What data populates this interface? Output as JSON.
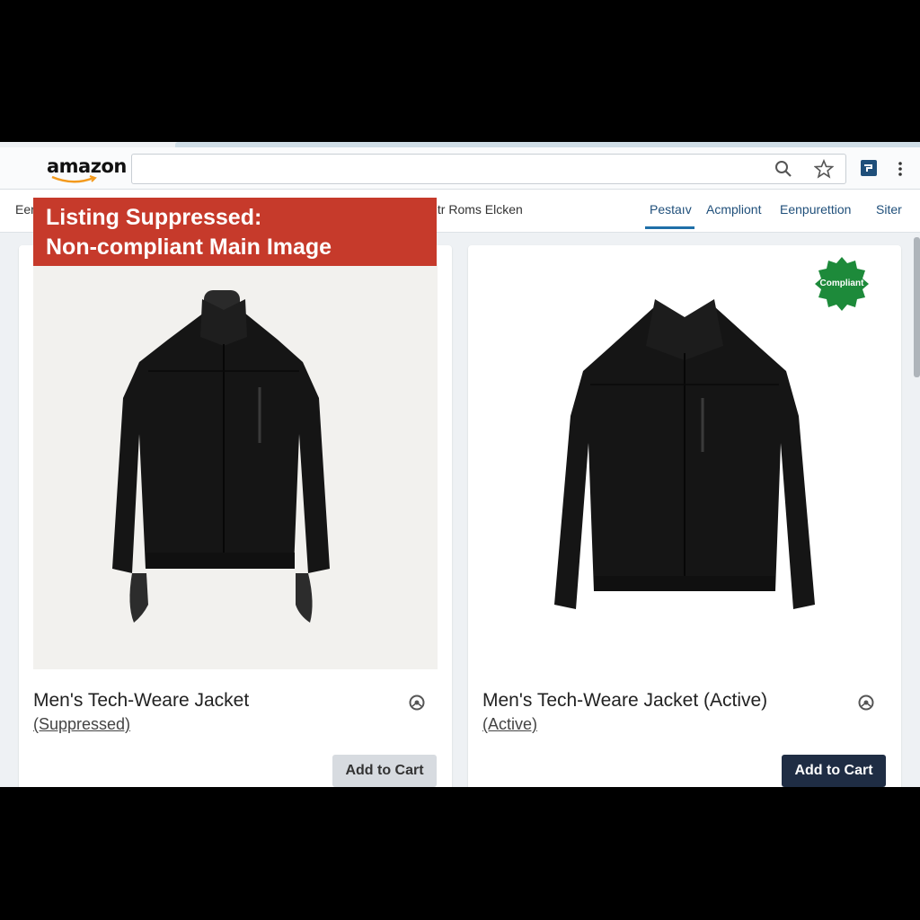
{
  "browser": {
    "logo_text": "amazon",
    "search": {
      "value": "",
      "placeholder": ""
    }
  },
  "nav": {
    "left_fragment": "Eer",
    "middle_text": "ıtr Roms Elcken",
    "tabs": [
      {
        "label": "Pestaıv",
        "active": true
      },
      {
        "label": "Acmpliont"
      },
      {
        "label": "Eenpurettion"
      },
      {
        "label": "Siter"
      }
    ]
  },
  "products": [
    {
      "banner": [
        "Listing Suppressed:",
        "Non-compliant Main Image"
      ],
      "title": "Men's Tech-Weare Jacket",
      "status": "(Suppressed)",
      "button": "Add to Cart"
    },
    {
      "badge": "Compliant",
      "title": "Men's Tech-Weare Jacket (Active)",
      "status": "(Active)",
      "button": "Add to Cart"
    }
  ],
  "colors": {
    "banner": "#c63a2b",
    "badge": "#1d8a3a",
    "button_primary": "#1f2d44",
    "button_disabled": "#d7dbe0",
    "accent": "#1f6fa8"
  },
  "icons": [
    "search-icon",
    "star-icon",
    "extension-icon",
    "menu-icon",
    "settings-icon"
  ]
}
